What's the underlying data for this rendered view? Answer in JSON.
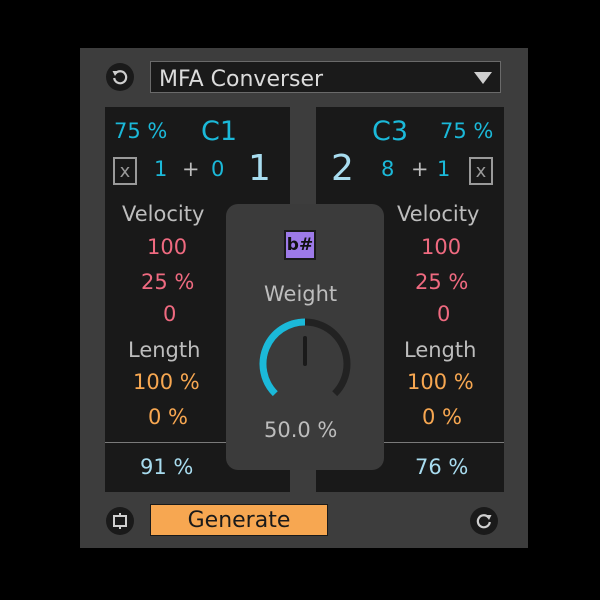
{
  "header": {
    "preset_name": "MFA Converser",
    "reset_icon": "reset-icon",
    "dropdown_icon": "triangle-down-icon"
  },
  "left": {
    "probability": "75 %",
    "note": "C1",
    "toggle": "x",
    "octave_a": "1",
    "plus": "+",
    "octave_b": "0",
    "voice_number": "1",
    "velocity_label": "Velocity",
    "velocity_value": "100",
    "velocity_random": "25 %",
    "velocity_offset": "0",
    "length_label": "Length",
    "length_value": "100 %",
    "length_random": "0 %",
    "footer_value": "91 %"
  },
  "right": {
    "probability": "75 %",
    "note": "C3",
    "toggle": "x",
    "octave_a": "8",
    "plus": "+",
    "octave_b": "1",
    "voice_number": "2",
    "velocity_label": "Velocity",
    "velocity_value": "100",
    "velocity_random": "25 %",
    "velocity_offset": "0",
    "length_label": "Length",
    "length_value": "100 %",
    "length_random": "0 %",
    "footer_value": "76 %"
  },
  "center": {
    "accidental_label": "b#",
    "weight_label": "Weight",
    "weight_value": "50.0 %",
    "weight_fraction": 0.5
  },
  "footer": {
    "generate_label": "Generate",
    "loop_icon": "loop-icon",
    "redo_icon": "redo-icon"
  },
  "colors": {
    "cyan": "#1bb9d9",
    "red": "#ef6a80",
    "orange": "#f7a751",
    "purple": "#9d7ae8",
    "knob_track": "#222222"
  }
}
